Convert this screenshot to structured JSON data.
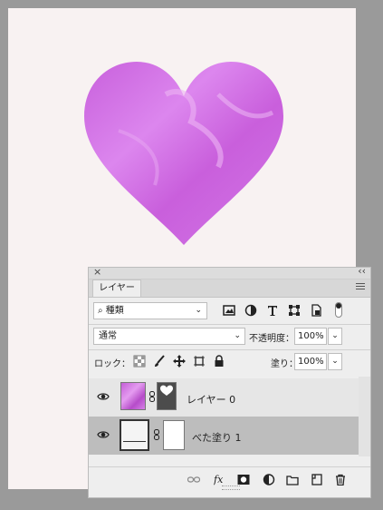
{
  "panel": {
    "tab_label": "レイヤー",
    "close_label": "×",
    "collapse_label": "‹‹"
  },
  "filter": {
    "search_glyph": "⌕",
    "kind_label": "種類"
  },
  "blend": {
    "mode": "通常",
    "opacity_label": "不透明度：",
    "opacity_value": "100%",
    "lock_label": "ロック：",
    "fill_label": "塗り：",
    "fill_value": "100%"
  },
  "layers": [
    {
      "name": "レイヤー 0",
      "visible": true,
      "selected": false
    },
    {
      "name": "べた塗り 1",
      "visible": true,
      "selected": true
    }
  ],
  "colors": {
    "heart": "#d070e0",
    "canvas": "#f8f2f2",
    "workspace": "#9a9a9a",
    "selected_row": "#bdbdbd"
  }
}
